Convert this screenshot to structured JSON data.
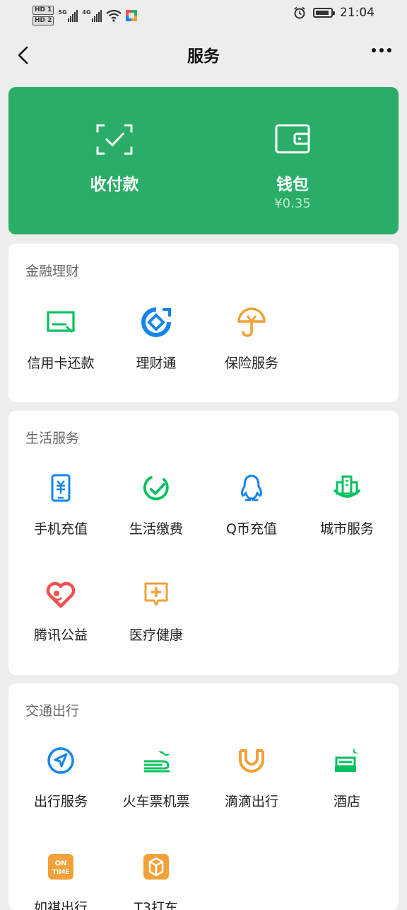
{
  "status_bar": {
    "hd1": "HD 1",
    "hd2": "HD 2",
    "sig1": "5G",
    "sig2": "4G",
    "time": "21:04"
  },
  "nav": {
    "title": "服务"
  },
  "wallet_card": {
    "pay": {
      "label": "收付款"
    },
    "wallet": {
      "label": "钱包",
      "balance": "¥0.35"
    }
  },
  "finance": {
    "title": "金融理财",
    "items": [
      {
        "label": "信用卡还款",
        "icon": "credit-card-icon"
      },
      {
        "label": "理财通",
        "icon": "licaitong-icon"
      },
      {
        "label": "保险服务",
        "icon": "insurance-icon"
      }
    ]
  },
  "life": {
    "title": "生活服务",
    "items": [
      {
        "label": "手机充值",
        "icon": "phone-topup-icon"
      },
      {
        "label": "生活缴费",
        "icon": "bill-pay-icon"
      },
      {
        "label": "Q币充值",
        "icon": "qq-coin-icon"
      },
      {
        "label": "城市服务",
        "icon": "city-service-icon"
      },
      {
        "label": "腾讯公益",
        "icon": "charity-icon"
      },
      {
        "label": "医疗健康",
        "icon": "medical-icon"
      }
    ]
  },
  "travel": {
    "title": "交通出行",
    "items": [
      {
        "label": "出行服务",
        "icon": "travel-service-icon"
      },
      {
        "label": "火车票机票",
        "icon": "train-plane-icon"
      },
      {
        "label": "滴滴出行",
        "icon": "didi-icon"
      },
      {
        "label": "酒店",
        "icon": "hotel-icon"
      },
      {
        "label": "如祺出行",
        "icon": "ontime-icon",
        "icon_text": "ON TIME"
      },
      {
        "label": "T3打车",
        "icon": "t3-icon"
      }
    ]
  },
  "colors": {
    "green": "#2aae67",
    "brand_green": "#07c160",
    "blue": "#1485ee",
    "orange": "#f0a138",
    "red": "#f05050"
  }
}
